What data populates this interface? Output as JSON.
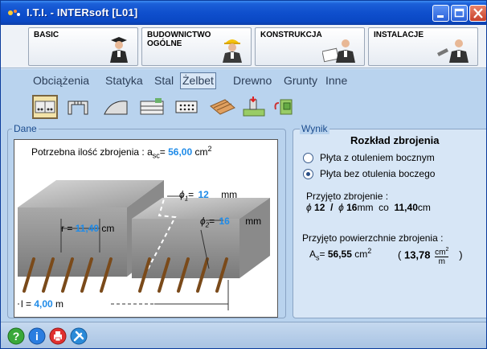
{
  "window": {
    "title": "I.T.I. - INTERsoft [L01]"
  },
  "modules": [
    {
      "label": "BASIC"
    },
    {
      "label": "BUDOWNICTWO\nOGÓLNE"
    },
    {
      "label": "KONSTRUKCJA"
    },
    {
      "label": "INSTALACJE"
    }
  ],
  "submenu": [
    {
      "label": "Obciążenia"
    },
    {
      "label": "Statyka"
    },
    {
      "label": "Stal"
    },
    {
      "label": "Żelbet",
      "active": true
    },
    {
      "label": "Drewno"
    },
    {
      "label": "Grunty"
    },
    {
      "label": "Inne"
    }
  ],
  "toolbar": {
    "tools": [
      "beam-section-tool",
      "column-tool",
      "shell-tool",
      "staircase-tool",
      "slab-tool",
      "reinforcement-tool",
      "foundation-tool",
      "stirrup-tool"
    ]
  },
  "dane": {
    "title": "Dane",
    "req_label": "Potrzebna ilość zbrojenia : a",
    "req_sub": "sc",
    "req_eq": "= ",
    "req_value": "56,00",
    "req_unit": "cm",
    "req_unit_sup": "2",
    "phi1_label": "= ",
    "phi1_value": "12",
    "phi1_unit": "mm",
    "phi2_label": "= ",
    "phi2_value": "16",
    "phi2_unit": "mm",
    "spacing_label": "r = ",
    "spacing_value": "11,40",
    "spacing_unit": "cm",
    "length_label": "l = ",
    "length_value": "4,00",
    "length_unit": "m"
  },
  "wynik": {
    "title": "Wynik",
    "heading": "Rozkład zbrojenia",
    "options": [
      {
        "label": "Płyta z otuleniem bocznym",
        "checked": false
      },
      {
        "label": "Płyta bez otulenia boczego",
        "checked": true
      }
    ],
    "adopted_label": "Przyjęto zbrojenie :",
    "adopted_phi1": "12",
    "adopted_sep": "/",
    "adopted_phi2": "16",
    "adopted_unit": "mm",
    "adopted_co": "co",
    "adopted_spacing": "11,40",
    "adopted_spacing_unit": "cm",
    "area_label": "Przyjęto powierzchnie zbrojenia :",
    "area_symbol": "A",
    "area_sub": "s",
    "area_eq": "= ",
    "area_value": "56,55",
    "area_unit": "cm",
    "area_unit_sup": "2",
    "per_m_open": "(",
    "per_m_value": "13,78",
    "per_m_num": "cm",
    "per_m_num_sup": "2",
    "per_m_den": "m",
    "per_m_close": ")"
  },
  "statusbar": {
    "icons": [
      "help-icon",
      "info-icon",
      "print-icon",
      "settings-icon"
    ]
  },
  "colors": {
    "accent_blue": "#1f8be8",
    "panel_bg": "#b9d3ee",
    "title_bar": "#0f4fcd"
  }
}
